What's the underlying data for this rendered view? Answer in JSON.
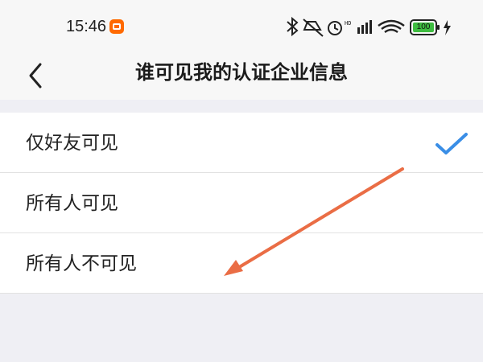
{
  "status_bar": {
    "time": "15:46",
    "battery": "100",
    "icons": [
      "bluetooth-icon",
      "mute-icon",
      "alarm-icon",
      "hd-signal-icon",
      "wifi-icon",
      "battery-icon",
      "charging-icon"
    ]
  },
  "header": {
    "title": "谁可见我的认证企业信息",
    "back_icon": "chevron-left-icon"
  },
  "options": [
    {
      "label": "仅好友可见",
      "selected": true
    },
    {
      "label": "所有人可见",
      "selected": false
    },
    {
      "label": "所有人不可见",
      "selected": false
    }
  ],
  "colors": {
    "accent": "#3a8ee6",
    "arrow": "#ea6d45",
    "background": "#efeff4"
  }
}
